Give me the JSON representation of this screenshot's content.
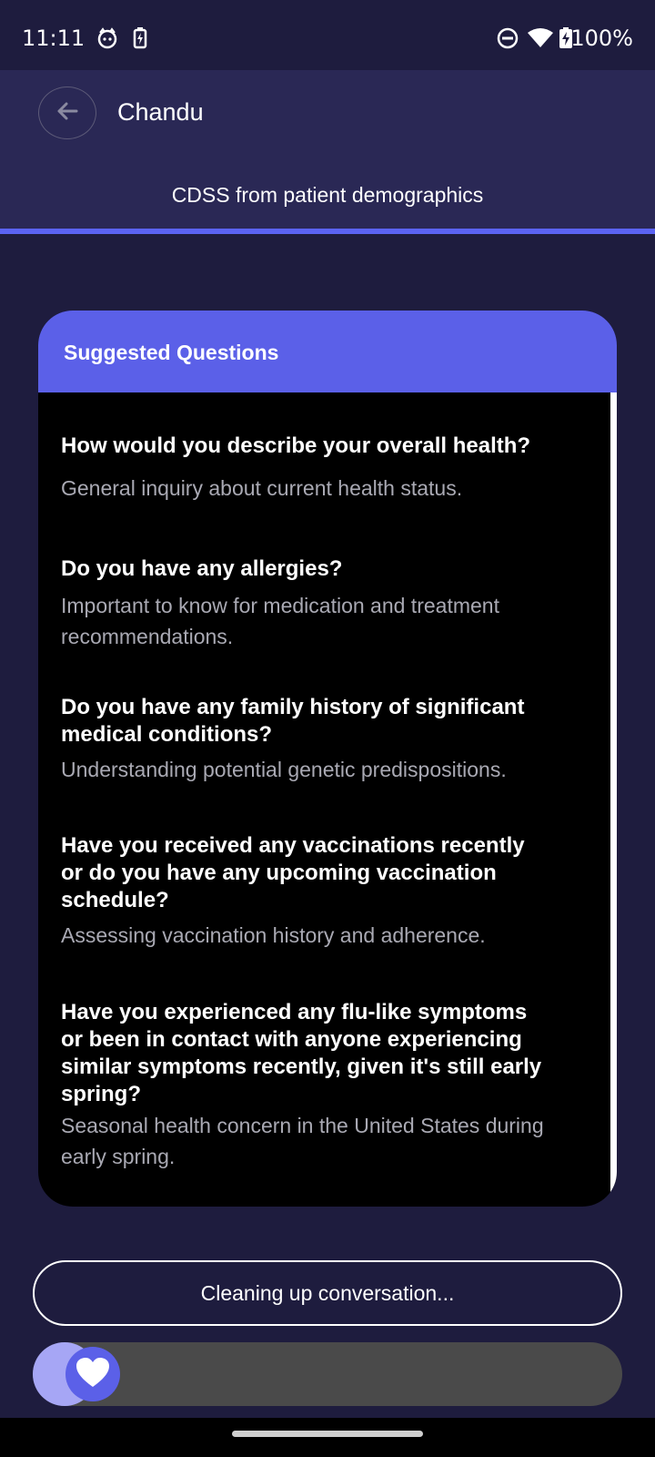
{
  "status_bar": {
    "time": "11:11",
    "battery": "100%",
    "icons": [
      "cat-notification-icon",
      "battery-saver-icon",
      "do-not-disturb-icon",
      "wifi-icon",
      "battery-charging-icon"
    ]
  },
  "header": {
    "title": "Chandu",
    "subtitle": "CDSS from patient demographics",
    "back_icon": "arrow-left-icon"
  },
  "suggested": {
    "title": "Suggested Questions",
    "questions": [
      {
        "title_lines": [
          "How would you describe your overall health?"
        ],
        "desc_lines": [
          "General inquiry about current health status."
        ]
      },
      {
        "title_lines": [
          "Do you have any allergies?"
        ],
        "desc_lines": [
          "Important to know for medication and treatment",
          "recommendations."
        ]
      },
      {
        "title_lines": [
          "Do you have any family history of significant",
          "medical conditions?"
        ],
        "desc_lines": [
          "Understanding potential genetic predispositions."
        ]
      },
      {
        "title_lines": [
          "Have you received any vaccinations recently",
          "or do you have any upcoming vaccination",
          "schedule?"
        ],
        "desc_lines": [
          "Assessing vaccination history and adherence."
        ]
      },
      {
        "title_lines": [
          "Have you experienced any flu-like symptoms",
          "or been in contact with anyone experiencing",
          "similar symptoms recently, given it's still early",
          "spring?"
        ],
        "desc_lines": [
          "Seasonal health concern in the United States during",
          "early spring."
        ]
      }
    ]
  },
  "actions": {
    "cleanup_label": "Cleaning up conversation...",
    "slider_icon": "heart-icon"
  },
  "colors": {
    "background": "#1e1c3e",
    "header": "#2a2855",
    "accent": "#5b60e8",
    "card": "#000000"
  }
}
